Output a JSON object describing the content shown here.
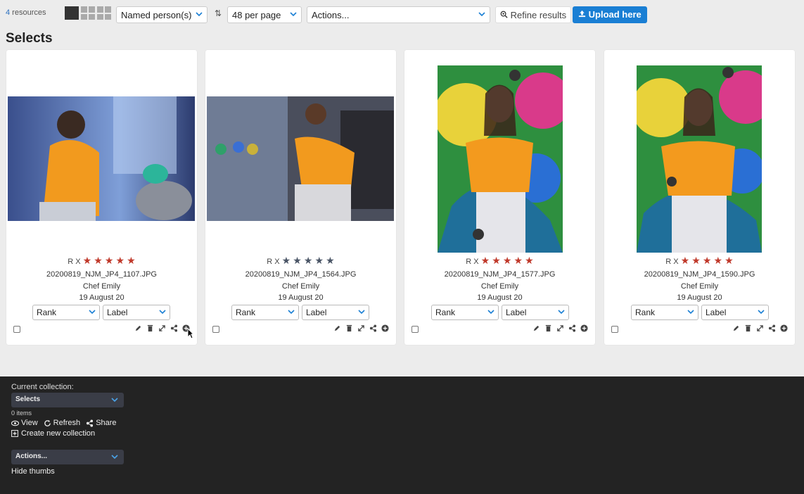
{
  "toolbar": {
    "resource_count": "4",
    "resource_label": " resources",
    "filter_select": "Named person(s)",
    "per_page_select": "48 per page",
    "actions_select": "Actions...",
    "refine_label": "Refine results",
    "upload_label": "Upload here"
  },
  "page": {
    "title": "Selects"
  },
  "cards": [
    {
      "rating_prefix": "R X",
      "stars_filled": 5,
      "filename": "20200819_NJM_JP4_1107.JPG",
      "person": "Chef Emily",
      "date": "19 August 20",
      "rank_label": "Rank",
      "label_label": "Label"
    },
    {
      "rating_prefix": "R X",
      "stars_filled": 0,
      "filename": "20200819_NJM_JP4_1564.JPG",
      "person": "Chef Emily",
      "date": "19 August 20",
      "rank_label": "Rank",
      "label_label": "Label"
    },
    {
      "rating_prefix": "R X",
      "stars_filled": 5,
      "filename": "20200819_NJM_JP4_1577.JPG",
      "person": "Chef Emily",
      "date": "19 August 20",
      "rank_label": "Rank",
      "label_label": "Label"
    },
    {
      "rating_prefix": "R X",
      "stars_filled": 5,
      "filename": "20200819_NJM_JP4_1590.JPG",
      "person": "Chef Emily",
      "date": "19 August 20",
      "rank_label": "Rank",
      "label_label": "Label"
    }
  ],
  "collection": {
    "label": "Current collection:",
    "selected": "Selects",
    "count": "0 items",
    "view": "View",
    "refresh": "Refresh",
    "share": "Share",
    "create": "Create new collection",
    "actions": "Actions...",
    "hide_thumbs": "Hide thumbs"
  },
  "colors": {
    "accent": "#1a7fd4",
    "star": "#c0392b",
    "star_dim": "#4a5566",
    "footer_bg": "#232323"
  }
}
